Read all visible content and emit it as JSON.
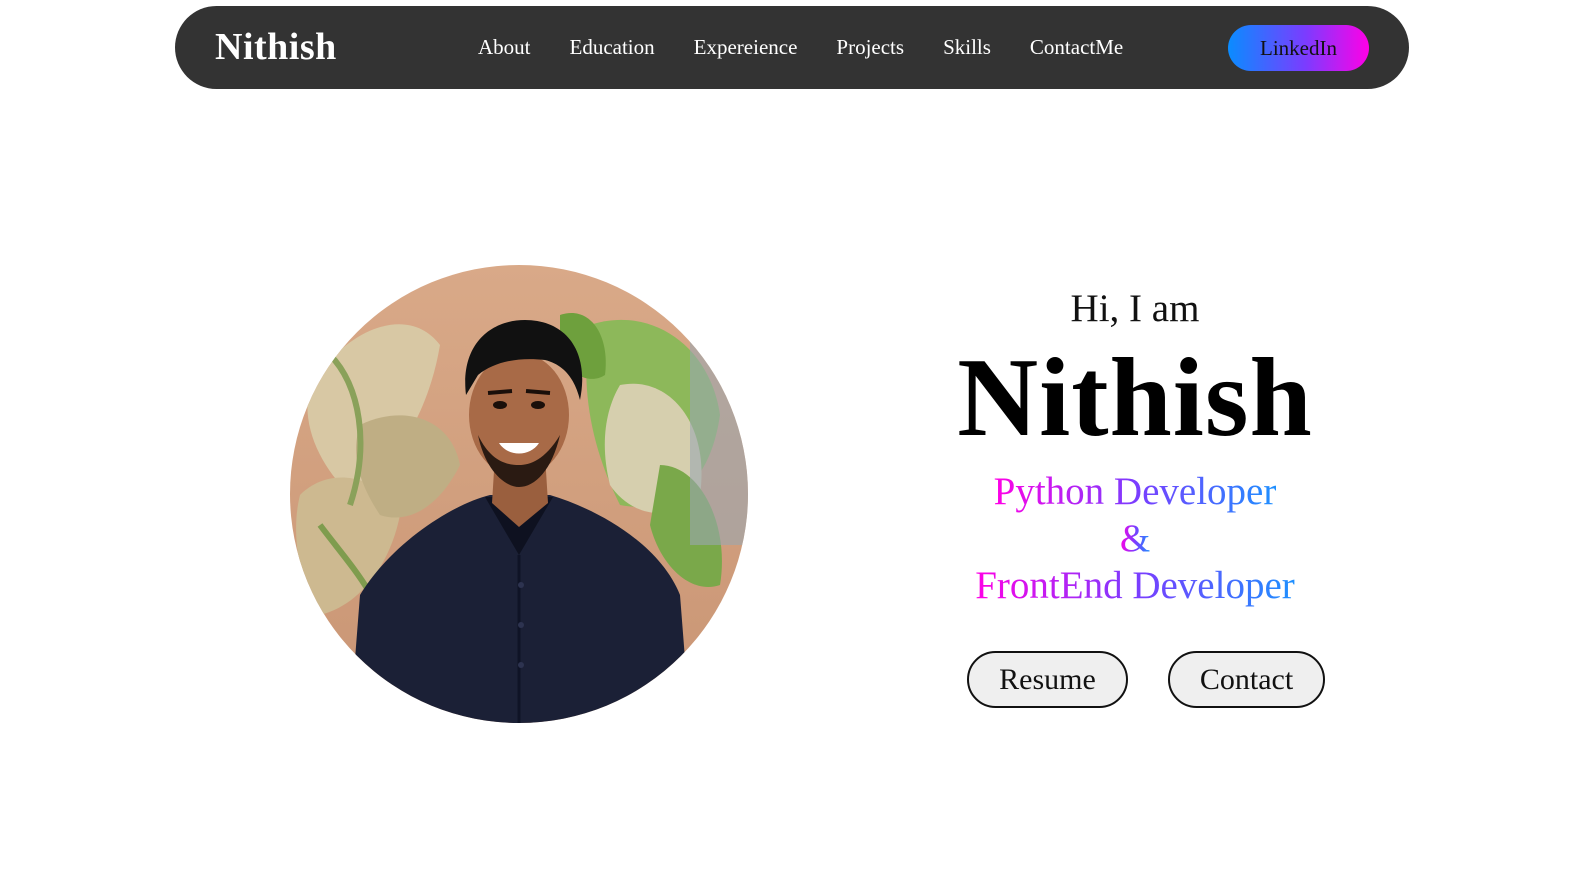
{
  "nav": {
    "brand": "Nithish",
    "links": [
      "About",
      "Education",
      "Expereience",
      "Projects",
      "Skills",
      "ContactMe"
    ],
    "linkedin_label": "LinkedIn"
  },
  "hero": {
    "greeting": "Hi, I am",
    "name": "Nithish",
    "role_1": "Python Developer",
    "role_sep": "&",
    "role_2": "FrontEnd Developer",
    "resume_label": "Resume",
    "contact_label": "Contact"
  },
  "colors": {
    "navbar_bg": "#333333",
    "gradient_start": "#ff00e6",
    "gradient_mid": "#7b3cff",
    "gradient_end": "#1e90ff"
  },
  "icons": {
    "avatar": "profile-photo"
  }
}
